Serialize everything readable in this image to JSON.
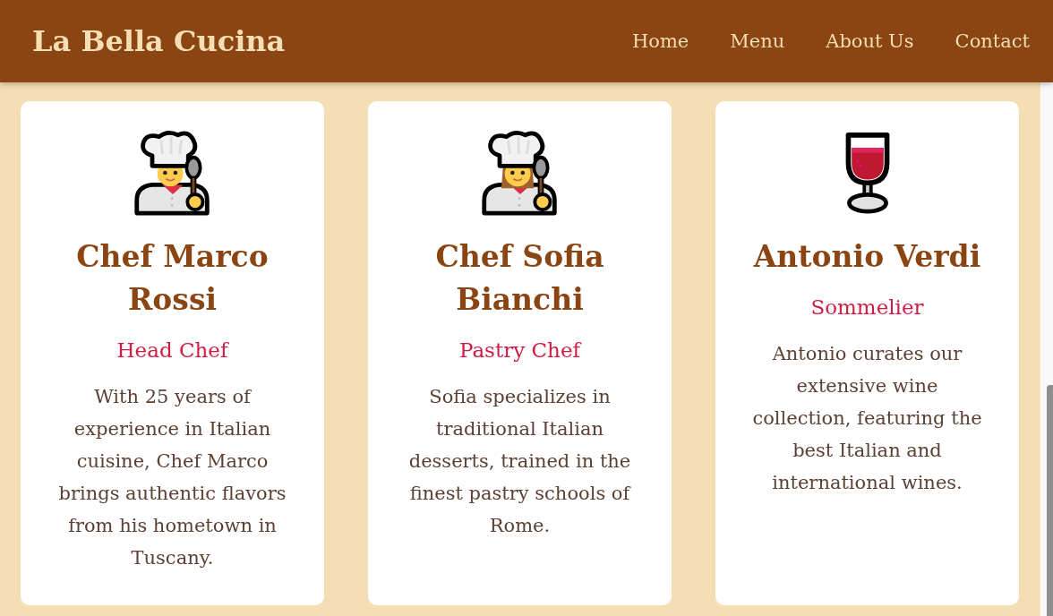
{
  "header": {
    "logo": "La Bella Cucina",
    "nav": [
      "Home",
      "Menu",
      "About Us",
      "Contact"
    ]
  },
  "team": [
    {
      "kind": "chef",
      "name": "Chef Marco Rossi",
      "role": "Head Chef",
      "bio": "With 25 years of experience in Italian cuisine, Chef Marco brings authentic flavors from his hometown in Tuscany."
    },
    {
      "kind": "chefwoman",
      "name": "Chef Sofia Bianchi",
      "role": "Pastry Chef",
      "bio": "Sofia specializes in traditional Italian desserts, trained in the finest pastry schools of Rome."
    },
    {
      "kind": "wine",
      "name": "Antonio Verdi",
      "role": "Sommelier",
      "bio": "Antonio curates our extensive wine collection, featuring the best Italian and international wines."
    }
  ]
}
